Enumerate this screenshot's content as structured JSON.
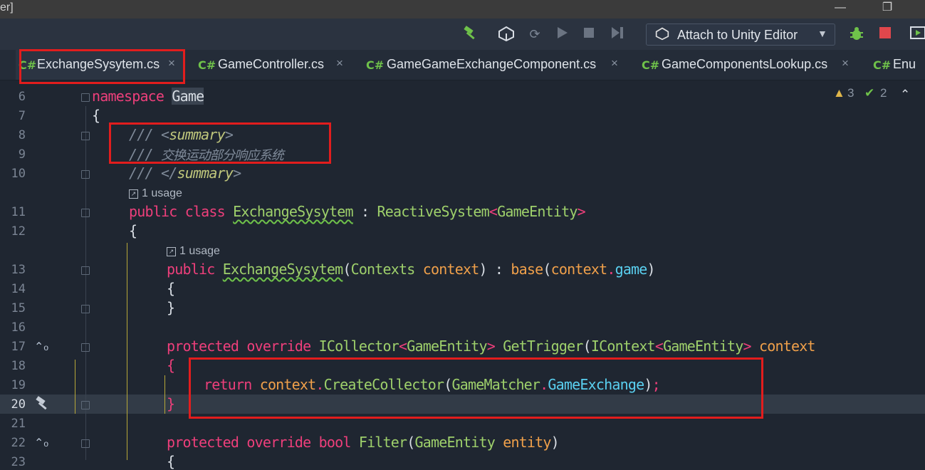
{
  "window": {
    "title_fragment": "er]",
    "minimize": "—",
    "maximize": "❐"
  },
  "toolbar": {
    "build_icon": "hammer-icon",
    "attach_label": "Attach to Unity Editor",
    "attach_icon": "unity-icon",
    "accent": "#6fc24a"
  },
  "tabs": [
    {
      "badge": "C#",
      "name": "ExchangeSysytem.cs",
      "close": "×"
    },
    {
      "badge": "C#",
      "name": "GameController.cs",
      "close": "×"
    },
    {
      "badge": "C#",
      "name": "GameGameExchangeComponent.cs",
      "close": "×"
    },
    {
      "badge": "C#",
      "name": "GameComponentsLookup.cs",
      "close": "×"
    },
    {
      "badge": "C#",
      "name": "Enu"
    }
  ],
  "inspections": {
    "warnings": "3",
    "checks": "2",
    "up": "⌃"
  },
  "line_numbers": [
    "6",
    "7",
    "8",
    "9",
    "10",
    "11",
    "12",
    "13",
    "14",
    "15",
    "16",
    "17",
    "18",
    "19",
    "20",
    "21",
    "22",
    "23"
  ],
  "codelens": {
    "usage1": "1 usage",
    "usage2": "1 usage"
  },
  "code": {
    "l6_kw": "namespace",
    "l6_name": "Game",
    "l7": "{",
    "l8_slash": "/// ",
    "l8_open": "<",
    "l8_tag": "summary",
    "l8_close": ">",
    "l9_slash": "/// ",
    "l9_text": "交换运动部分响应系统",
    "l10_slash": "/// ",
    "l10_open": "</",
    "l10_tag": "summary",
    "l10_close": ">",
    "l11_kw1": "public",
    "l11_kw2": "class",
    "l11_name": "ExchangeSysytem",
    "l11_colon": " : ",
    "l11_base": "ReactiveSystem",
    "l11_lt": "<",
    "l11_gen": "GameEntity",
    "l11_gt": ">",
    "l12": "{",
    "l13_kw": "public",
    "l13_name": "ExchangeSysytem",
    "l13_p1": "(",
    "l13_type": "Contexts",
    "l13_param": "context",
    "l13_p2": ") : ",
    "l13_base": "base",
    "l13_p3": "(",
    "l13_arg": "context",
    "l13_dot": ".",
    "l13_prop": "game",
    "l13_p4": ")",
    "l14": "{",
    "l15": "}",
    "l17_kw1": "protected",
    "l17_kw2": "override",
    "l17_type": "ICollector",
    "l17_lt": "<",
    "l17_gen": "GameEntity",
    "l17_gt": ">",
    "l17_name": "GetTrigger",
    "l17_p1": "(",
    "l17_ptype": "IContext",
    "l17_lt2": "<",
    "l17_gen2": "GameEntity",
    "l17_gt2": ">",
    "l17_param": "context",
    "l18": "{",
    "l19_kw": "return",
    "l19_obj": "context",
    "l19_dot": ".",
    "l19_call": "CreateCollector",
    "l19_p1": "(",
    "l19_cls": "GameMatcher",
    "l19_dot2": ".",
    "l19_prop": "GameExchange",
    "l19_p2": ")",
    "l19_semi": ";",
    "l20": "}",
    "l22_kw1": "protected",
    "l22_kw2": "override",
    "l22_kw3": "bool",
    "l22_name": "Filter",
    "l22_p1": "(",
    "l22_type": "GameEntity",
    "l22_param": "entity",
    "l22_p2": ")",
    "l23": "{"
  }
}
